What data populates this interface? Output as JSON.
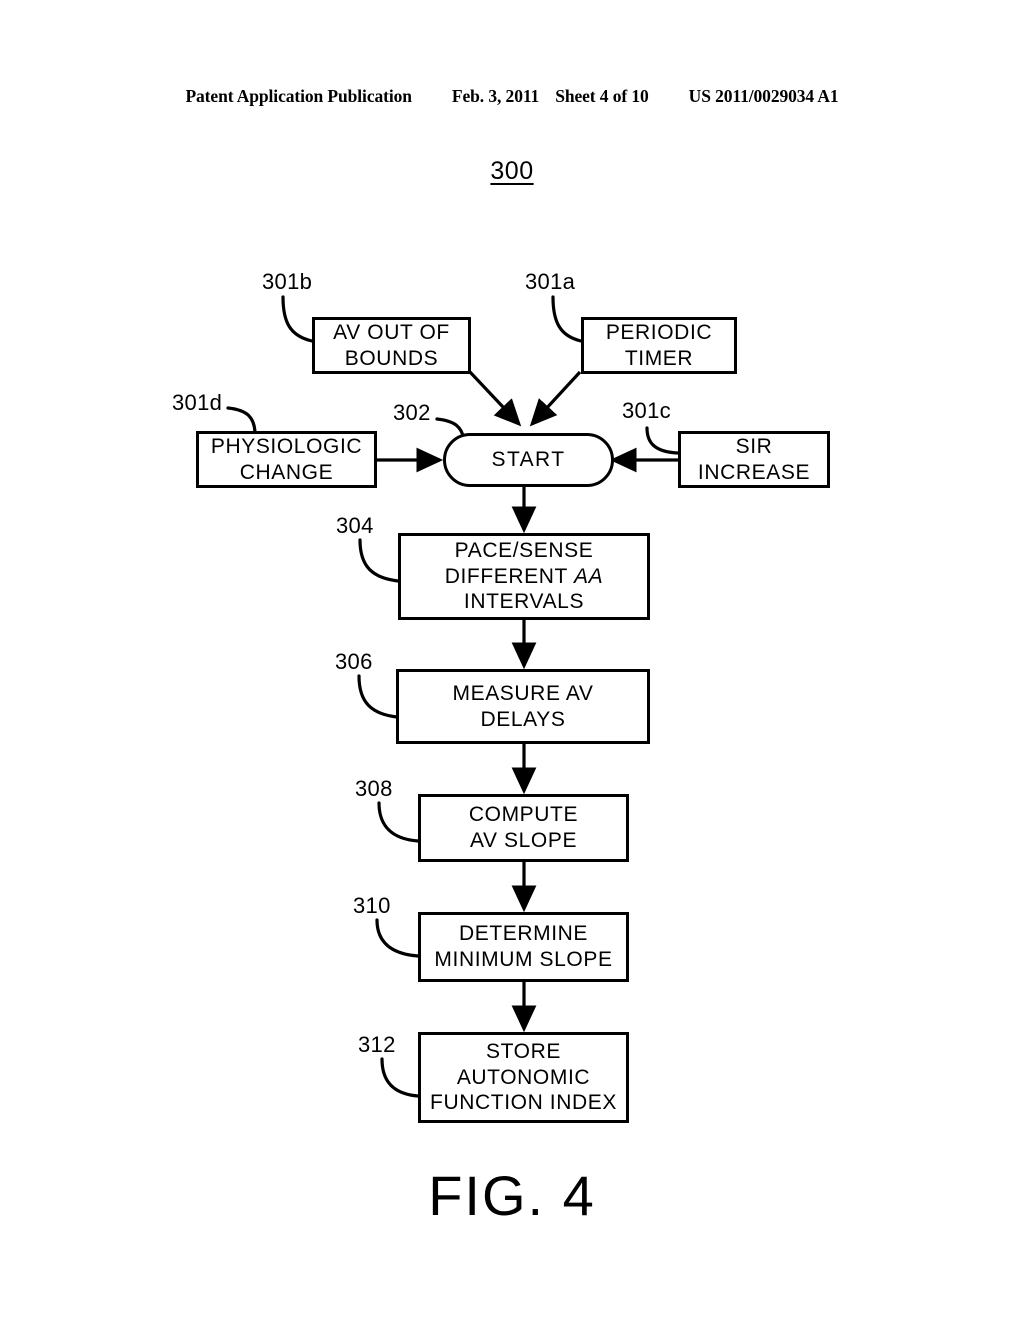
{
  "header": {
    "publication": "Patent Application Publication",
    "date": "Feb. 3, 2011",
    "sheet": "Sheet 4 of 10",
    "patent_number": "US 2011/0029034 A1"
  },
  "figure": {
    "diagram_ref": "300",
    "caption": "FIG. 4"
  },
  "nodes": {
    "av_out_of_bounds": {
      "line1": "AV OUT OF",
      "line2": "BOUNDS",
      "ref": "301b"
    },
    "periodic_timer": {
      "line1": "PERIODIC",
      "line2": "TIMER",
      "ref": "301a"
    },
    "physiologic_change": {
      "line1": "PHYSIOLOGIC",
      "line2": "CHANGE",
      "ref": "301d"
    },
    "sir_increase": {
      "line1": "SIR",
      "line2": "INCREASE",
      "ref": "301c"
    },
    "start": {
      "line1": "START",
      "ref": "302"
    },
    "pace_sense": {
      "line1": "PACE/SENSE",
      "line2": "DIFFERENT ",
      "line2_italic": "AA",
      "line3": "INTERVALS",
      "ref": "304"
    },
    "measure_av_delays": {
      "line1": "MEASURE AV",
      "line2": "DELAYS",
      "ref": "306"
    },
    "compute_av_slope": {
      "line1": "COMPUTE",
      "line2": "AV SLOPE",
      "ref": "308"
    },
    "determine_min_slope": {
      "line1": "DETERMINE",
      "line2": "MINIMUM SLOPE",
      "ref": "310"
    },
    "store_autonomic": {
      "line1": "STORE",
      "line2": "AUTONOMIC",
      "line3": "FUNCTION INDEX",
      "ref": "312"
    }
  },
  "colors": {
    "ink": "#000000",
    "paper": "#ffffff"
  }
}
